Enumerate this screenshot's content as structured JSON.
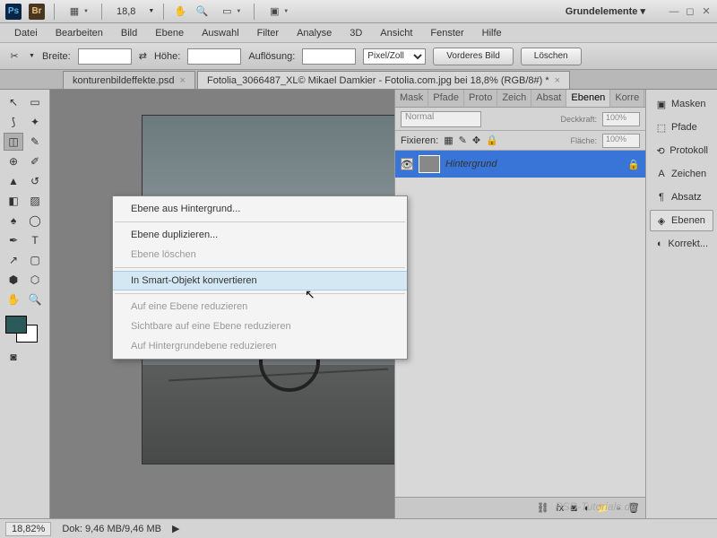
{
  "titlebar": {
    "zoom": "18,8",
    "workspace": "Grundelemente ▾"
  },
  "menu": [
    "Datei",
    "Bearbeiten",
    "Bild",
    "Ebene",
    "Auswahl",
    "Filter",
    "Analyse",
    "3D",
    "Ansicht",
    "Fenster",
    "Hilfe"
  ],
  "optbar": {
    "width_lbl": "Breite:",
    "height_lbl": "Höhe:",
    "res_lbl": "Auflösung:",
    "unit": "Pixel/Zoll",
    "front": "Vorderes Bild",
    "clear": "Löschen"
  },
  "tabs": [
    {
      "label": "konturenbildeffekte.psd",
      "active": false
    },
    {
      "label": "Fotolia_3066487_XL© Mikael Damkier - Fotolia.com.jpg bei 18,8% (RGB/8#) *",
      "active": true
    }
  ],
  "panel": {
    "tabs": [
      "Mask",
      "Pfade",
      "Proto",
      "Zeich",
      "Absat",
      "Ebenen",
      "Korre"
    ],
    "active_tab": "Ebenen",
    "blend": "Normal",
    "opacity_lbl": "Deckkraft:",
    "opacity": "100%",
    "lock_lbl": "Fixieren:",
    "fill_lbl": "Fläche:",
    "fill": "100%",
    "layer_name": "Hintergrund"
  },
  "side": [
    {
      "ico": "▣",
      "label": "Masken"
    },
    {
      "ico": "⬚",
      "label": "Pfade"
    },
    {
      "ico": "⟲",
      "label": "Protokoll"
    },
    {
      "ico": "A",
      "label": "Zeichen"
    },
    {
      "ico": "¶",
      "label": "Absatz"
    },
    {
      "ico": "◈",
      "label": "Ebenen"
    },
    {
      "ico": "◐",
      "label": "Korrekt..."
    }
  ],
  "ctx": [
    {
      "label": "Ebene aus Hintergrund...",
      "type": "item"
    },
    {
      "type": "sep"
    },
    {
      "label": "Ebene duplizieren...",
      "type": "item"
    },
    {
      "label": "Ebene löschen",
      "type": "disabled"
    },
    {
      "type": "sep"
    },
    {
      "label": "In Smart-Objekt konvertieren",
      "type": "hover"
    },
    {
      "type": "sep"
    },
    {
      "label": "Auf eine Ebene reduzieren",
      "type": "disabled"
    },
    {
      "label": "Sichtbare auf eine Ebene reduzieren",
      "type": "disabled"
    },
    {
      "label": "Auf Hintergrundebene reduzieren",
      "type": "disabled"
    }
  ],
  "status": {
    "zoom": "18,82%",
    "doc": "Dok: 9,46 MB/9,46 MB"
  },
  "watermark": "PSD-Tutorials.de"
}
